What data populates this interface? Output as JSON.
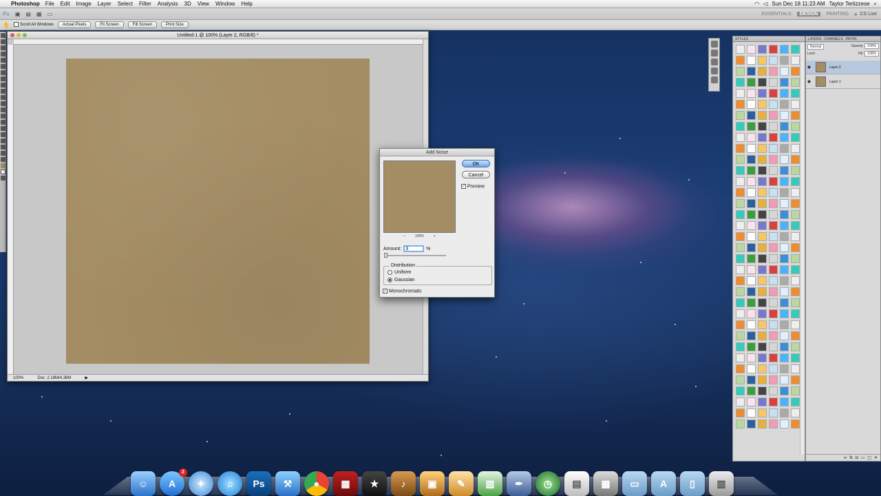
{
  "menubar": {
    "app": "Photoshop",
    "menus": [
      "File",
      "Edit",
      "Image",
      "Layer",
      "Select",
      "Filter",
      "Analysis",
      "3D",
      "View",
      "Window",
      "Help"
    ],
    "datetime": "Sun Dec 18  11:23 AM",
    "user": "Taylor Terlizzese",
    "workspaces": [
      "ESSENTIALS",
      "DESIGN",
      "PAINTING"
    ],
    "cs_live": "CS Live"
  },
  "optionsbar": {
    "scroll_all": "Scroll All Windows",
    "buttons": [
      "Actual Pixels",
      "Fit Screen",
      "Fill Screen",
      "Print Size"
    ]
  },
  "document": {
    "title": "Untitled-1 @ 100% (Layer 2, RGB/8) *",
    "zoom": "100%",
    "doc_size": "Doc: 2.18M/4.38M"
  },
  "dialog": {
    "title": "Add Noise",
    "ok": "OK",
    "cancel": "Cancel",
    "preview_label": "Preview",
    "preview_checked": true,
    "zoom_minus": "–",
    "zoom_value": "100%",
    "zoom_plus": "+",
    "amount_label": "Amount:",
    "amount_value": "3",
    "amount_unit": "%",
    "distribution_label": "Distribution",
    "uniform": "Uniform",
    "gaussian": "Gaussian",
    "selected_distribution": "Gaussian",
    "monochromatic": "Monochromatic",
    "monochromatic_checked": true
  },
  "panels": {
    "styles_tab": "STYLES",
    "layers_tabs": [
      "LAYERS",
      "CHANNELS",
      "PATHS"
    ],
    "blend_mode": "Normal",
    "opacity_label": "Opacity:",
    "opacity_value": "100%",
    "lock_label": "Lock:",
    "fill_label": "Fill:",
    "fill_value": "100%",
    "layers": [
      "Layer 2",
      "Layer 1"
    ]
  },
  "dock": {
    "badge": "2",
    "ps_label": "Ps"
  },
  "colors": {
    "canvas": "#a48d64",
    "ok_button": "#6fa6ea"
  }
}
